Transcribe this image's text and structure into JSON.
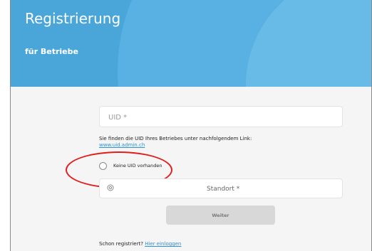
{
  "header": {
    "title": "Registrierung",
    "subtitle": "für Betriebe",
    "color": "#4aa6d9"
  },
  "form": {
    "uid_placeholder": "UID *",
    "hint_text": "Sie finden die UID Ihres Betriebes unter nachfolgendem Link:",
    "hint_link": "www.uid.admin.ch",
    "no_uid_label": "Keine UID vorhanden",
    "location_icon": "location-target-icon",
    "standort_placeholder": "Standort *",
    "submit_label": "Weiter",
    "already_registered": "Schon registriert?",
    "login_link": "Hier einloggen"
  },
  "annotation": {
    "color": "#e01e1e"
  }
}
